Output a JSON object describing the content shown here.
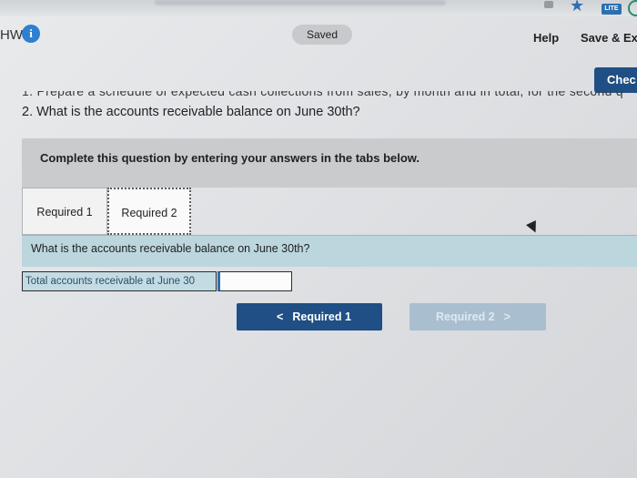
{
  "browser": {
    "lite_badge": "LITE",
    "star_icon": "star-icon"
  },
  "header": {
    "hw_label": "HW",
    "info_icon": "i",
    "saved_label": "Saved",
    "help_label": "Help",
    "save_exit_label": "Save & Exi",
    "check_label": "Chec"
  },
  "question": {
    "cut_text": "1. Prepare a schedule of expected cash collections from sales, by month and in total, for the second q",
    "q2_text": "2. What is the accounts receivable balance on June 30th?"
  },
  "panel": {
    "instruction": "Complete this question by entering your answers in the tabs below."
  },
  "tabs": [
    {
      "label": "Required 1"
    },
    {
      "label": "Required 2"
    }
  ],
  "prompt": "What is the accounts receivable balance on June 30th?",
  "answer": {
    "label": "Total accounts receivable at June 30",
    "value": ""
  },
  "nav": {
    "prev_label": "Required 1",
    "prev_chevron": "<",
    "next_label": "Required 2",
    "next_chevron": ">"
  },
  "colors": {
    "primary": "#1f4f84",
    "disabled": "#a9bfd0",
    "info_blue": "#2d7fd0",
    "question_bar": "#bcd6de"
  }
}
